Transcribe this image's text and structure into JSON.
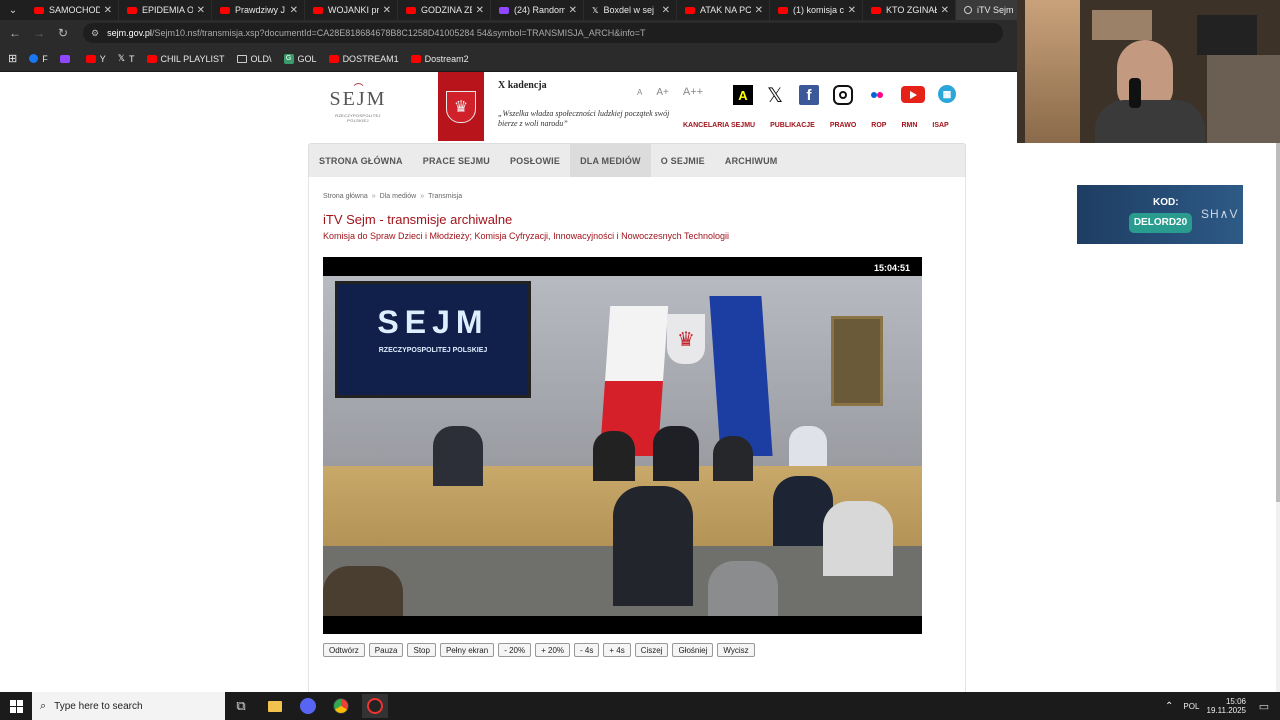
{
  "browser": {
    "tabs": [
      {
        "label": "SAMOCHOD",
        "icon": "youtube-icon"
      },
      {
        "label": "EPIDEMIA O",
        "icon": "youtube-icon"
      },
      {
        "label": "Prawdziwy J",
        "icon": "youtube-icon"
      },
      {
        "label": "WOJANKI pr",
        "icon": "youtube-icon"
      },
      {
        "label": "GODZINA ZE",
        "icon": "youtube-icon"
      },
      {
        "label": "(24) Random",
        "icon": "twitch-icon"
      },
      {
        "label": "Boxdel w sej",
        "icon": "x-icon"
      },
      {
        "label": "ATAK NA PC",
        "icon": "youtube-icon"
      },
      {
        "label": "(1) komisja c",
        "icon": "youtube-icon"
      },
      {
        "label": "KTO ZGINAŁ",
        "icon": "youtube-icon"
      },
      {
        "label": "iTV Sejm",
        "icon": "itv-icon"
      }
    ],
    "tab_close": "✕",
    "url_host": "sejm.gov.pl",
    "url_path": "/Sejm10.nsf/transmisja.xsp?documentId=CA28E818684678B8C1258D41005284 54&symbol=TRANSMISJA_ARCH&info=T",
    "bookmarks": [
      {
        "label": "F",
        "icon": "facebook-icon"
      },
      {
        "label": "",
        "icon": "twitch-icon"
      },
      {
        "label": "Y",
        "icon": "youtube-icon"
      },
      {
        "label": "T",
        "icon": "x-icon"
      },
      {
        "label": "CHIL PLAYLIST",
        "icon": "youtube-icon"
      },
      {
        "label": "OLD\\",
        "icon": "folder-icon"
      },
      {
        "label": "GOL",
        "icon": "gol-icon"
      },
      {
        "label": "DOSTREAM1",
        "icon": "youtube-icon"
      },
      {
        "label": "Dostream2",
        "icon": "youtube-icon"
      }
    ]
  },
  "site": {
    "logo_text": "SEJM",
    "logo_sub": "RZECZYPOSPOLITEJ POLSKIEJ",
    "kadencja": "X kadencja",
    "quote": "„Wszelka władza społeczności ludzkiej początek swój bierze z woli narodu”",
    "font_sizes": [
      "A",
      "A+",
      "A++"
    ],
    "contrast_label": "A",
    "top_links": [
      "KANCELARIA SEJMU",
      "PUBLIKACJE",
      "PRAWO",
      "ROP",
      "RMN",
      "ISAP"
    ],
    "nav": [
      "STRONA GŁÓWNA",
      "PRACE SEJMU",
      "POSŁOWIE",
      "DLA MEDIÓW",
      "O SEJMIE",
      "ARCHIWUM"
    ],
    "nav_selected": 3,
    "breadcrumbs": [
      "Strona główna",
      "Dla mediów",
      "Transmisja"
    ],
    "breadcrumb_sep": "»",
    "title": "iTV Sejm - transmisje archiwalne",
    "subtitle": "Komisja do Spraw Dzieci i Młodzieży; Komisja Cyfryzacji, Innowacyjności i Nowoczesnych Technologii",
    "video_time": "15:04:51",
    "screen_text": "SEJM",
    "screen_sub": "RZECZYPOSPOLITEJ POLSKIEJ",
    "controls": [
      "Odtwórz",
      "Pauza",
      "Stop",
      "Pełny ekran",
      "- 20%",
      "+ 20%",
      "- 4s",
      "+ 4s",
      "Ciszej",
      "Głośniej",
      "Wycisz"
    ]
  },
  "promo": {
    "label": "KOD:",
    "code": "DELORD20",
    "brand": "SH∧V"
  },
  "taskbar": {
    "search_placeholder": "Type here to search",
    "lang": "POL",
    "time": "15:06",
    "date": "19.11.2025"
  }
}
